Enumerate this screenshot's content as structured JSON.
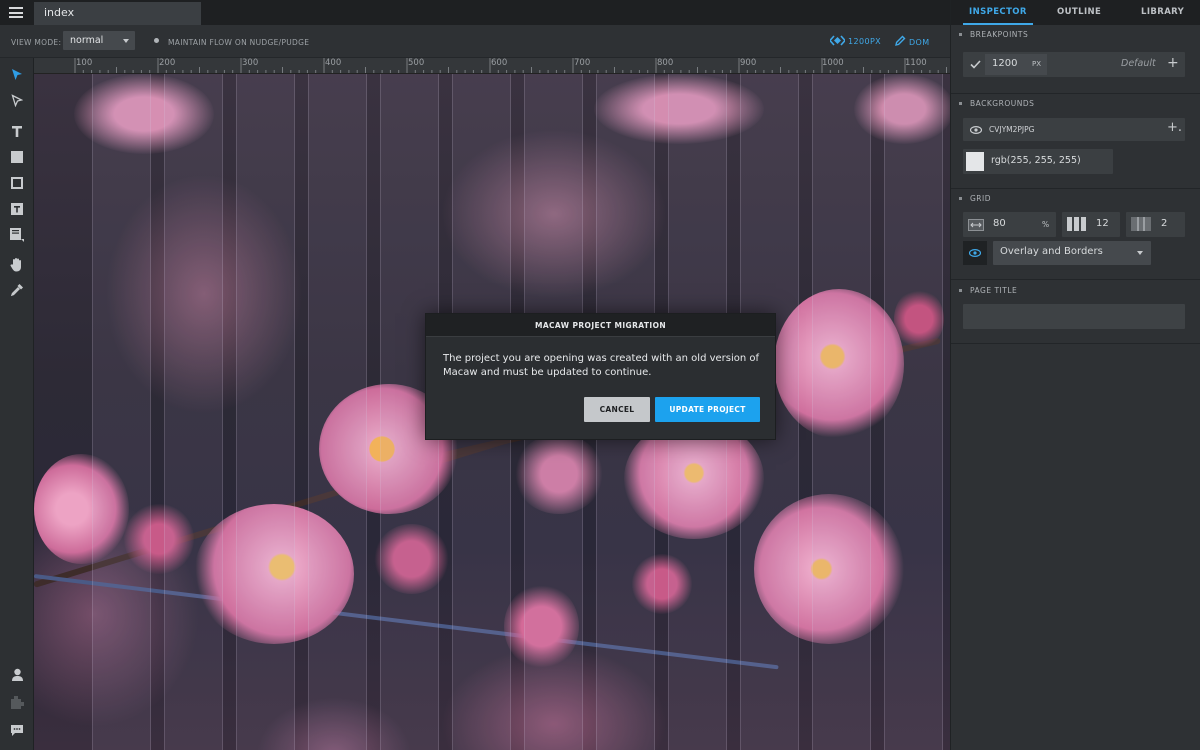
{
  "document_tab": {
    "label": "index"
  },
  "toolbar": {
    "view_mode_label": "VIEW MODE:",
    "view_mode_value": "normal",
    "maintain_flow_label": "MAINTAIN FLOW ON NUDGE/PUDGE",
    "breakpoint_label": "1200PX",
    "dom_label": "DOM"
  },
  "ruler": {
    "ticks": [
      "100",
      "200",
      "300",
      "400",
      "500",
      "600",
      "700",
      "800",
      "900",
      "1000",
      "1100"
    ]
  },
  "dialog": {
    "title": "MACAW PROJECT MIGRATION",
    "message": "The project you are opening was created with an old version of Macaw and must be updated to continue.",
    "cancel_label": "CANCEL",
    "update_label": "UPDATE PROJECT"
  },
  "panel": {
    "tabs": {
      "inspector": "INSPECTOR",
      "outline": "OUTLINE",
      "library": "LIBRARY"
    },
    "breakpoints": {
      "heading": "BREAKPOINTS",
      "value": "1200",
      "unit": "PX",
      "default_label": "Default"
    },
    "backgrounds": {
      "heading": "BACKGROUNDS",
      "image_name": "CVJYM2PJPG",
      "color": "rgb(255, 255, 255)"
    },
    "grid": {
      "heading": "GRID",
      "width": "80",
      "width_unit": "%",
      "columns": "12",
      "gutter": "2",
      "display_mode": "Overlay and Borders"
    },
    "page_title": {
      "heading": "PAGE TITLE",
      "value": ""
    }
  },
  "colors": {
    "accent": "#1ca2ee",
    "panel_bg": "#2e3134",
    "topbar_bg": "#1e2022"
  },
  "icons": [
    "menu-icon",
    "select-arrow-icon",
    "direct-select-icon",
    "text-icon",
    "filled-box-icon",
    "outline-box-icon",
    "text-box-icon",
    "image-icon",
    "hand-icon",
    "eyedropper-icon",
    "user-icon",
    "puzzle-icon",
    "chat-icon",
    "checkmark-icon",
    "plus-icon",
    "eye-icon",
    "plus-add-icon",
    "grid-width-icon",
    "columns-icon",
    "gutter-icon",
    "breakpoint-icon",
    "pencil-icon"
  ]
}
